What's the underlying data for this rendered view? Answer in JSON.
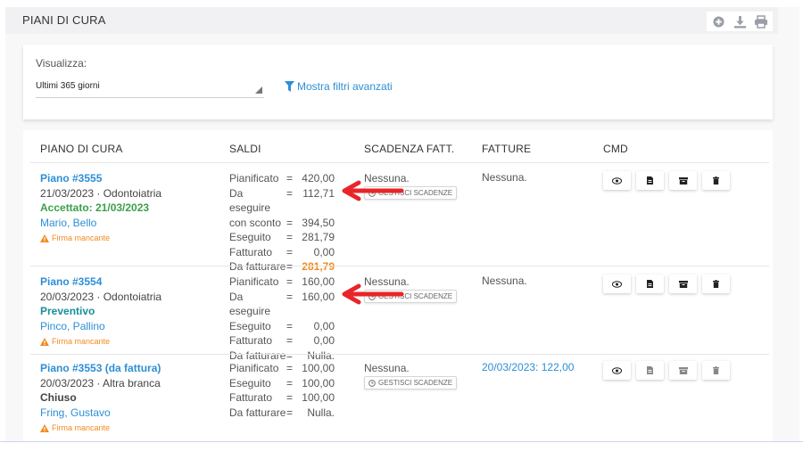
{
  "header": {
    "title": "PIANI DI CURA",
    "icons": [
      "add-circle-icon",
      "download-icon",
      "print-icon"
    ]
  },
  "filter": {
    "label": "Visualizza:",
    "select_value": "Ultimi 365 giorni",
    "advanced_filters": "Mostra filtri avanzati"
  },
  "table": {
    "headers": [
      "PIANO DI CURA",
      "SALDI",
      "SCADENZA FATT.",
      "FATTURE",
      "CMD"
    ],
    "rows": [
      {
        "name": "Piano #3555",
        "info": "21/03/2023 · Odontoiatria",
        "status": "Accettato: 21/03/2023",
        "patient": "Mario, Bello",
        "warning": "Firma mancante",
        "saldi": [
          {
            "k": "Pianificato",
            "v": "420,00"
          },
          {
            "k": "Da eseguire",
            "v": "112,71"
          },
          {
            "k": "con sconto",
            "v": "394,50"
          },
          {
            "k": "Eseguito",
            "v": "281,79"
          },
          {
            "k": "Fatturato",
            "v": "0,00"
          },
          {
            "k": "Da fatturare",
            "v": "281,79"
          }
        ],
        "scadenza": "Nessuna.",
        "gestisci": "GESTISCI SCADENZE",
        "fatture": "Nessuna."
      },
      {
        "name": "Piano #3554",
        "info": "20/03/2023 · Odontoiatria",
        "status": "Preventivo",
        "patient": "Pinco, Pallino",
        "warning": "Firma mancante",
        "saldi": [
          {
            "k": "Pianificato",
            "v": "160,00"
          },
          {
            "k": "Da eseguire",
            "v": "160,00"
          },
          {
            "k": "Eseguito",
            "v": "0,00"
          },
          {
            "k": "Fatturato",
            "v": "0,00"
          },
          {
            "k": "Da fatturare",
            "v": "Nulla."
          }
        ],
        "scadenza": "Nessuna.",
        "gestisci": "GESTISCI SCADENZE",
        "fatture": "Nessuna."
      },
      {
        "name": "Piano #3553 (da fattura)",
        "info": "20/03/2023 · Altra branca",
        "status": "Chiuso",
        "patient": "Fring, Gustavo",
        "warning": "Firma mancante",
        "saldi": [
          {
            "k": "Pianificato",
            "v": "100,00"
          },
          {
            "k": "Eseguito",
            "v": "100,00"
          },
          {
            "k": "Fatturato",
            "v": "100,00"
          },
          {
            "k": "Da fatturare",
            "v": "Nulla."
          }
        ],
        "scadenza": "Nessuna.",
        "gestisci": "GESTISCI SCADENZE",
        "fatture": "20/03/2023: 122,00"
      }
    ],
    "cmd_icons": [
      "view-eye-icon",
      "document-icon",
      "archive-icon",
      "delete-icon"
    ]
  },
  "colors": {
    "link": "#2d8fd5",
    "accepted": "#3aa04a",
    "estimate": "#17909a",
    "warning": "#f28a1e",
    "annotation_arrow": "#e8252a"
  }
}
